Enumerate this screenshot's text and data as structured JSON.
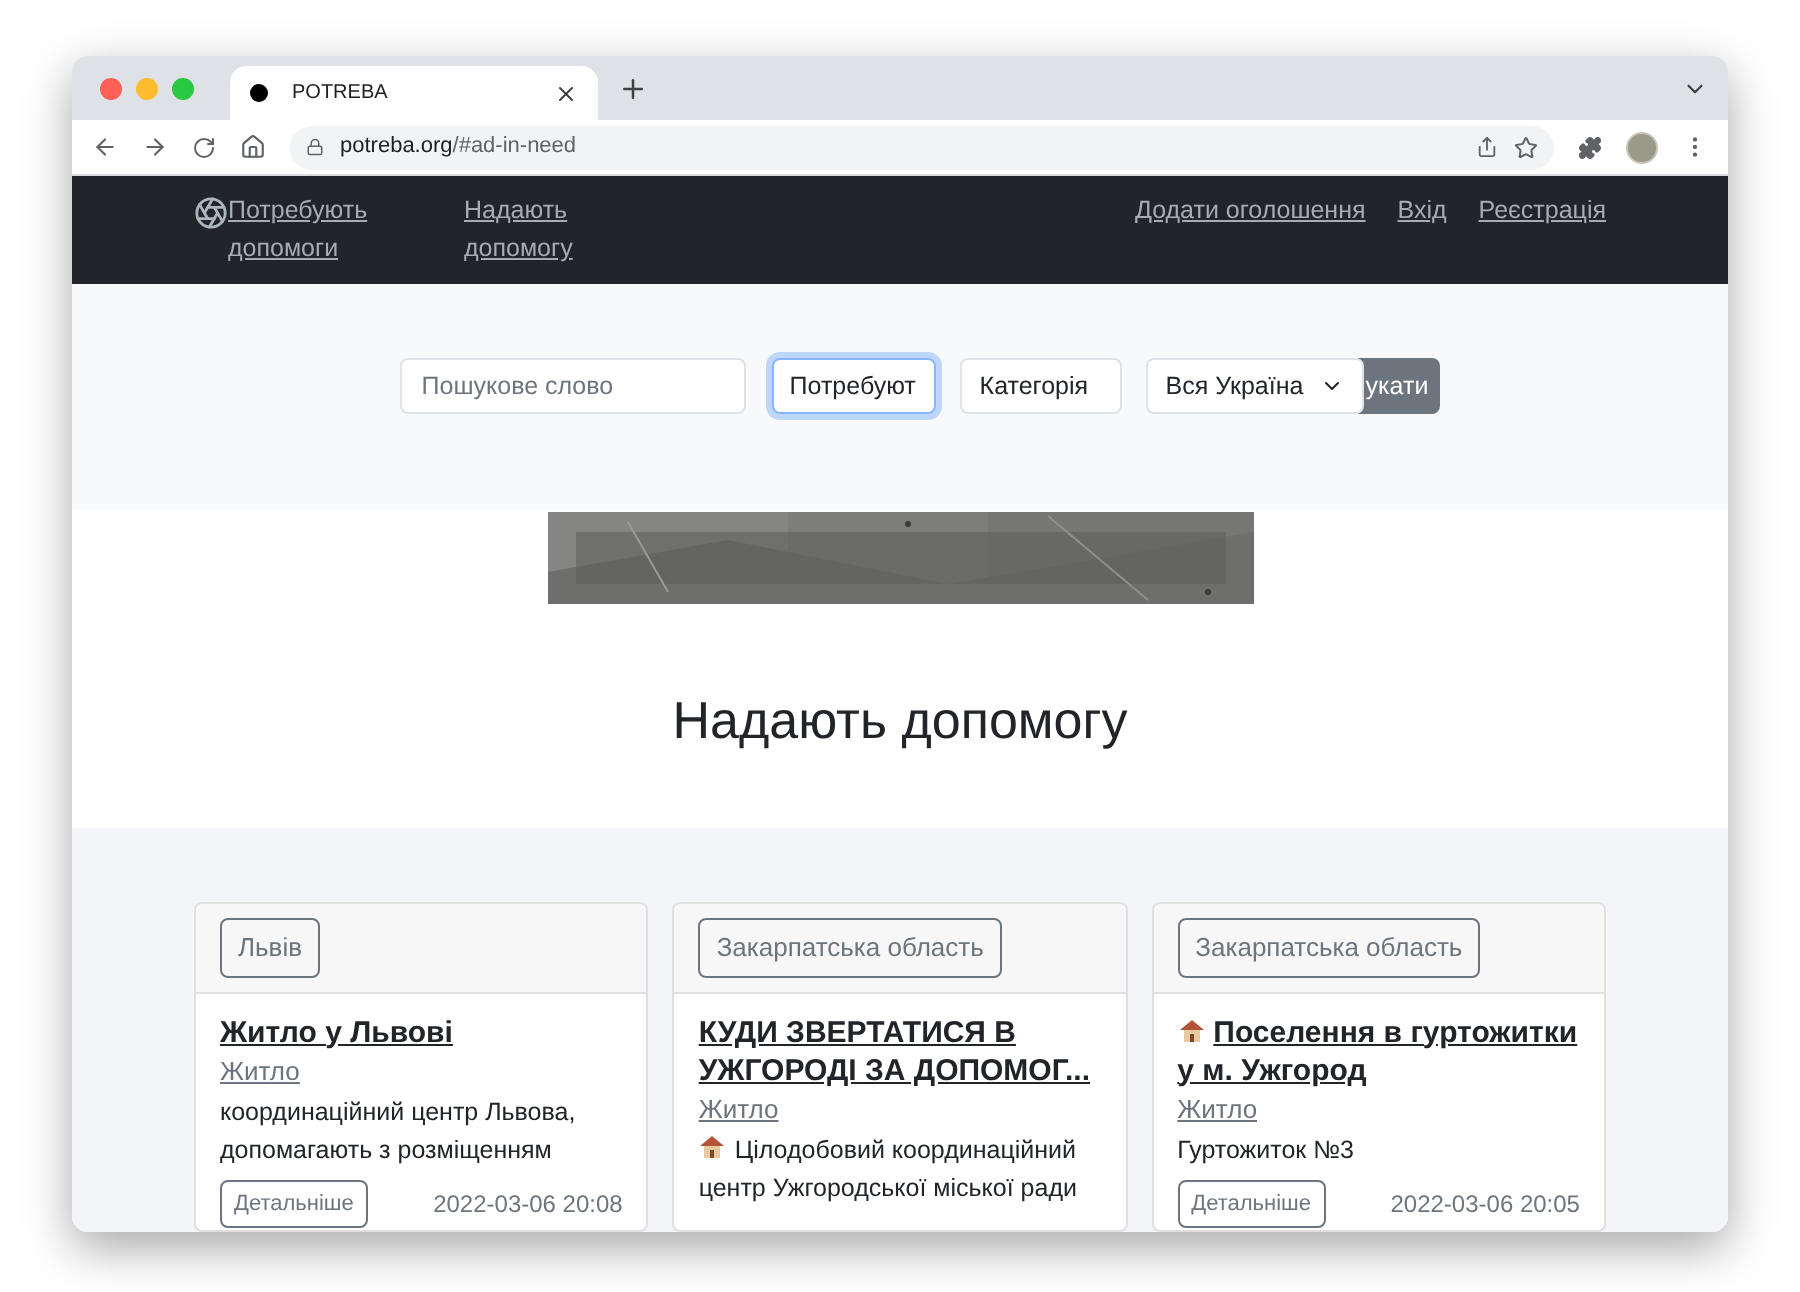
{
  "browser": {
    "tab_title": "POTREBA",
    "url": "**potreba.org**/#ad-in-need"
  },
  "nav": {
    "left_links": [
      "Потребують допомоги",
      "Надають допомогу"
    ],
    "right_links": [
      "Додати оголошення",
      "Вхід",
      "Реєстрація"
    ]
  },
  "search": {
    "keyword_placeholder": "Пошукове слово",
    "type_value": "Потребуют",
    "type_focused": true,
    "category_value": "Категорія",
    "region_value": "Вся Україна",
    "search_button": "укати"
  },
  "heading": "Надають допомогу",
  "cards": [
    {
      "region": "Львів",
      "title": "Житло у Львові",
      "title_icon": false,
      "category": "Житло",
      "description": "координаційний центр Львова, допомагають з розміщенням",
      "description_icon": false,
      "details": "Детальніше",
      "date": "2022-03-06 20:08"
    },
    {
      "region": "Закарпатська область",
      "title": "КУДИ ЗВЕРТАТИСЯ В УЖГОРОДІ ЗА ДОПОМОГ...",
      "title_icon": false,
      "category": "Житло",
      "description": "Цілодобовий координаційний центр Ужгородської міської ради",
      "description_icon": true
    },
    {
      "region": "Закарпатська область",
      "title": "Поселення в гуртожитки у м. Ужгород",
      "title_icon": true,
      "category": "Житло",
      "description": "Гуртожиток №3",
      "description_icon": false,
      "details": "Детальніше",
      "date": "2022-03-06 20:05"
    }
  ]
}
